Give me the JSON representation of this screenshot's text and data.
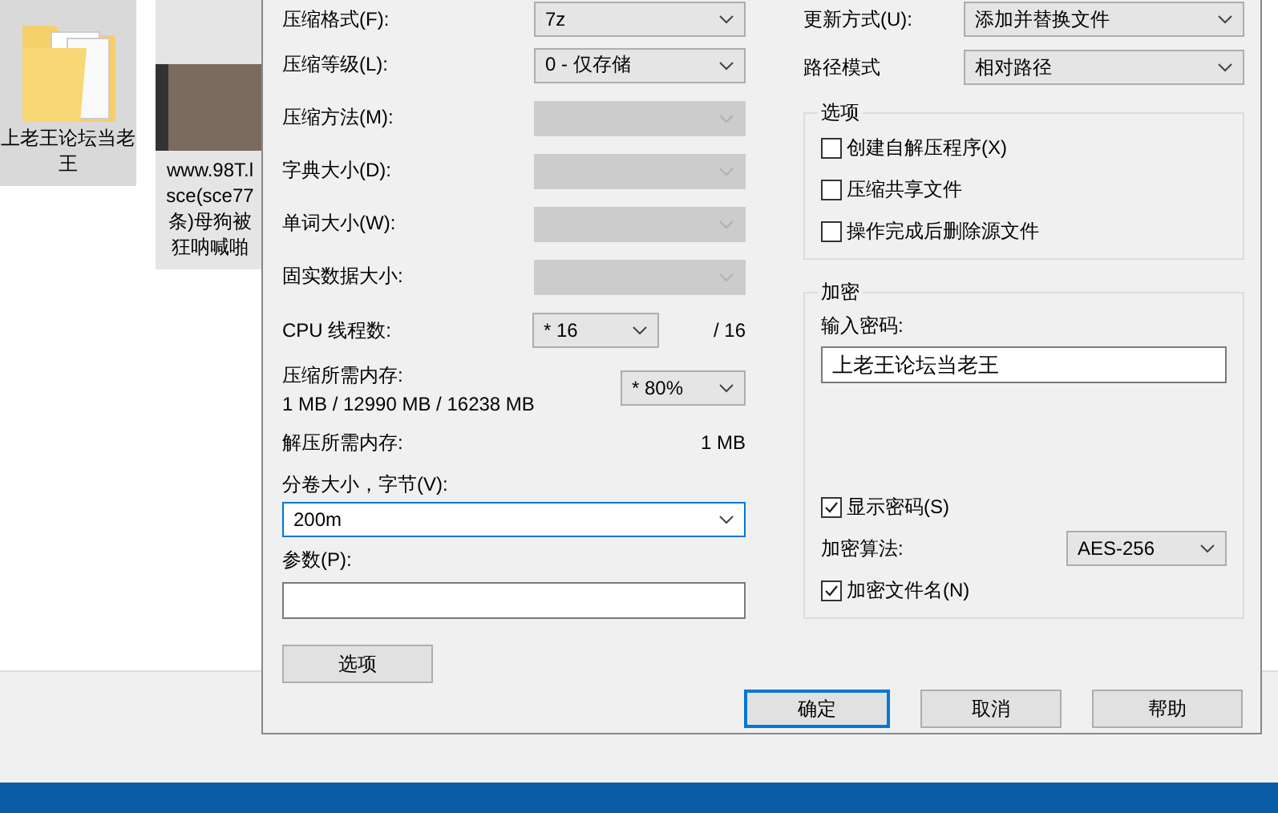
{
  "desktop_items": [
    {
      "kind": "folder",
      "selected": true,
      "lines": [
        "上老王论坛当老",
        "王"
      ]
    },
    {
      "kind": "video",
      "selected": false,
      "lines": [
        "www.98T.l",
        "sce(sce77",
        "条)母狗被",
        "狂呐喊啪"
      ]
    }
  ],
  "dialog": {
    "left_rows": [
      {
        "label": "压缩格式(F):",
        "value": "7z",
        "disabled": false
      },
      {
        "label": "压缩等级(L):",
        "value": "0 - 仅存储",
        "disabled": false
      },
      {
        "label": "压缩方法(M):",
        "disabled": true
      },
      {
        "label": "字典大小(D):",
        "disabled": true
      },
      {
        "label": "单词大小(W):",
        "disabled": true
      },
      {
        "label": "固实数据大小:",
        "disabled": true
      }
    ],
    "threads": {
      "label": "CPU 线程数:",
      "value": "* 16",
      "max": "/ 16"
    },
    "memory": {
      "label": "压缩所需内存:",
      "detail": "1 MB / 12990 MB / 16238 MB",
      "value": "* 80%"
    },
    "decompress_memory": {
      "label": "解压所需内存:",
      "value": "1 MB"
    },
    "volume": {
      "label": "分卷大小，字节(V):",
      "value": "200m",
      "focused": true
    },
    "parameters": {
      "label": "参数(P):"
    },
    "options_button": "选项",
    "update_mode": {
      "label": "更新方式(U):",
      "value": "添加并替换文件"
    },
    "path_mode": {
      "label": "路径模式",
      "value": "相对路径"
    },
    "options_group": {
      "title": "选项",
      "checkboxes": [
        {
          "label": "创建自解压程序(X)",
          "checked": false
        },
        {
          "label": "压缩共享文件",
          "checked": false
        },
        {
          "label": "操作完成后删除源文件",
          "checked": false
        }
      ]
    },
    "encryption": {
      "title": "加密",
      "password_label": "输入密码:",
      "password": "上老王论坛当老王",
      "show_password": {
        "label": "显示密码(S)",
        "checked": true
      },
      "method": {
        "label": "加密算法:",
        "value": "AES-256"
      },
      "encrypt_names": {
        "label": "加密文件名(N)",
        "checked": true
      }
    },
    "buttons": [
      {
        "label": "确定",
        "default": true
      },
      {
        "label": "取消",
        "default": false
      },
      {
        "label": "帮助",
        "default": false
      }
    ]
  }
}
